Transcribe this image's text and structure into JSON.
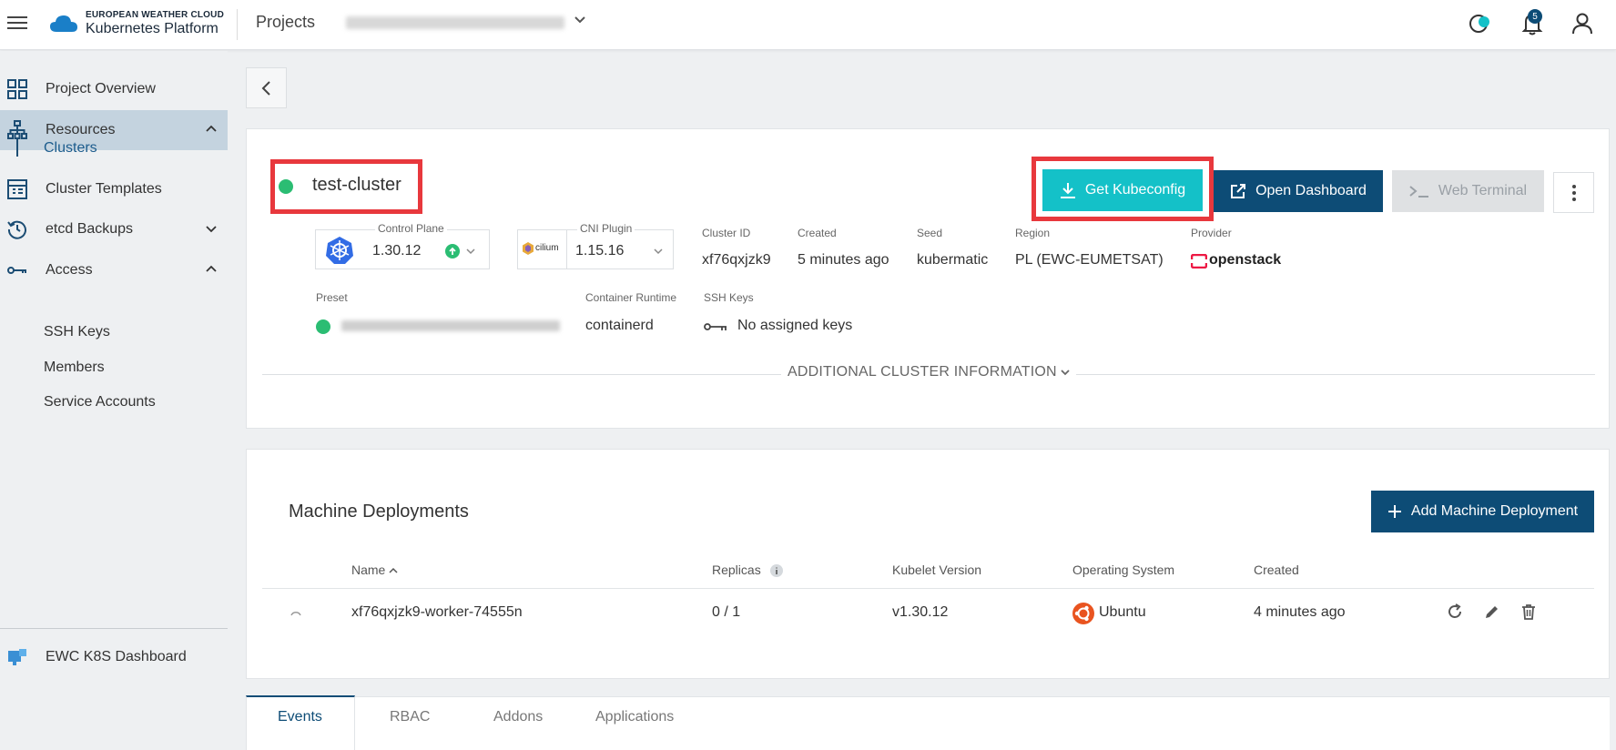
{
  "header": {
    "logo_line1": "EUROPEAN WEATHER CLOUD",
    "logo_line2": "Kubernetes Platform",
    "projects_label": "Projects",
    "notification_count": "5"
  },
  "sidebar": {
    "project_overview": "Project Overview",
    "resources": "Resources",
    "clusters": "Clusters",
    "cluster_templates": "Cluster Templates",
    "etcd_backups": "etcd Backups",
    "access": "Access",
    "ssh_keys": "SSH Keys",
    "members": "Members",
    "service_accounts": "Service Accounts",
    "dashboard": "EWC K8S Dashboard"
  },
  "cluster": {
    "name": "test-cluster",
    "status_color": "#2bbd73",
    "buttons": {
      "get_kubeconfig": "Get Kubeconfig",
      "open_dashboard": "Open Dashboard",
      "web_terminal": "Web Terminal"
    },
    "control_plane_label": "Control Plane",
    "control_plane_version": "1.30.12",
    "cni_label": "CNI Plugin",
    "cni_logo_text": "cilium",
    "cni_version": "1.15.16",
    "cluster_id_label": "Cluster ID",
    "cluster_id": "xf76qxjzk9",
    "created_label": "Created",
    "created": "5 minutes ago",
    "seed_label": "Seed",
    "seed": "kubermatic",
    "region_label": "Region",
    "region": "PL (EWC-EUMETSAT)",
    "provider_label": "Provider",
    "provider": "openstack",
    "preset_label": "Preset",
    "container_runtime_label": "Container Runtime",
    "container_runtime": "containerd",
    "ssh_keys_label": "SSH Keys",
    "ssh_keys_value": "No assigned keys",
    "additional_info": "ADDITIONAL CLUSTER INFORMATION"
  },
  "machine_deployments": {
    "title": "Machine Deployments",
    "add_button": "Add Machine Deployment",
    "columns": {
      "name": "Name",
      "replicas": "Replicas",
      "kubelet": "Kubelet Version",
      "os": "Operating System",
      "created": "Created"
    },
    "rows": [
      {
        "name": "xf76qxjzk9-worker-74555n",
        "replicas": "0 / 1",
        "kubelet": "v1.30.12",
        "os": "Ubuntu",
        "created": "4 minutes ago"
      }
    ]
  },
  "tabs": [
    "Events",
    "RBAC",
    "Addons",
    "Applications"
  ],
  "colors": {
    "accent_teal": "#14c1c8",
    "primary_dark": "#0d4c76",
    "highlight_red": "#e8383d"
  }
}
